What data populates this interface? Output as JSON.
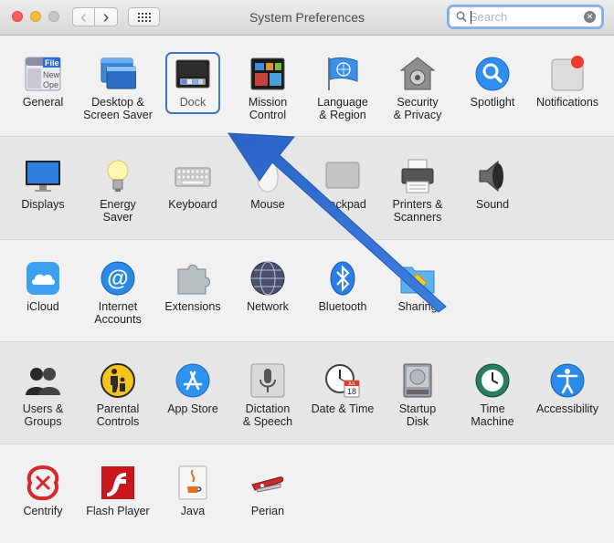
{
  "window": {
    "title": "System Preferences",
    "nav_back": "‹",
    "nav_forward": "›"
  },
  "search": {
    "placeholder": "Search",
    "value": "",
    "clear": "✕"
  },
  "selected": "Dock",
  "sections": [
    {
      "items": [
        {
          "id": "general",
          "label": "General",
          "icon": "general-icon",
          "icon_text": [
            "File",
            "New",
            "Ope"
          ]
        },
        {
          "id": "desktop",
          "label": "Desktop &\nScreen Saver",
          "icon": "desktop-screensaver-icon"
        },
        {
          "id": "dock",
          "label": "Dock",
          "icon": "dock-icon"
        },
        {
          "id": "mission",
          "label": "Mission\nControl",
          "icon": "mission-control-icon"
        },
        {
          "id": "language",
          "label": "Language\n& Region",
          "icon": "language-region-icon"
        },
        {
          "id": "security",
          "label": "Security\n& Privacy",
          "icon": "security-privacy-icon"
        },
        {
          "id": "spotlight",
          "label": "Spotlight",
          "icon": "spotlight-icon"
        },
        {
          "id": "notifications",
          "label": "Notifications",
          "icon": "notifications-icon"
        }
      ]
    },
    {
      "items": [
        {
          "id": "displays",
          "label": "Displays",
          "icon": "displays-icon"
        },
        {
          "id": "energy",
          "label": "Energy\nSaver",
          "icon": "energy-saver-icon"
        },
        {
          "id": "keyboard",
          "label": "Keyboard",
          "icon": "keyboard-icon"
        },
        {
          "id": "mouse",
          "label": "Mouse",
          "icon": "mouse-icon"
        },
        {
          "id": "trackpad",
          "label": "Trackpad",
          "icon": "trackpad-icon"
        },
        {
          "id": "printers",
          "label": "Printers &\nScanners",
          "icon": "printers-scanners-icon"
        },
        {
          "id": "sound",
          "label": "Sound",
          "icon": "sound-icon"
        }
      ]
    },
    {
      "items": [
        {
          "id": "icloud",
          "label": "iCloud",
          "icon": "icloud-icon"
        },
        {
          "id": "internet",
          "label": "Internet\nAccounts",
          "icon": "internet-accounts-icon"
        },
        {
          "id": "extensions",
          "label": "Extensions",
          "icon": "extensions-icon"
        },
        {
          "id": "network",
          "label": "Network",
          "icon": "network-icon"
        },
        {
          "id": "bluetooth",
          "label": "Bluetooth",
          "icon": "bluetooth-icon"
        },
        {
          "id": "sharing",
          "label": "Sharing",
          "icon": "sharing-icon"
        }
      ]
    },
    {
      "items": [
        {
          "id": "users",
          "label": "Users &\nGroups",
          "icon": "users-groups-icon"
        },
        {
          "id": "parental",
          "label": "Parental\nControls",
          "icon": "parental-controls-icon"
        },
        {
          "id": "appstore",
          "label": "App Store",
          "icon": "app-store-icon"
        },
        {
          "id": "dictation",
          "label": "Dictation\n& Speech",
          "icon": "dictation-speech-icon"
        },
        {
          "id": "datetime",
          "label": "Date & Time",
          "icon": "date-time-icon",
          "icon_text": [
            "JUL",
            "18"
          ]
        },
        {
          "id": "startup",
          "label": "Startup\nDisk",
          "icon": "startup-disk-icon"
        },
        {
          "id": "timemachine",
          "label": "Time\nMachine",
          "icon": "time-machine-icon"
        },
        {
          "id": "accessibility",
          "label": "Accessibility",
          "icon": "accessibility-icon"
        }
      ]
    },
    {
      "items": [
        {
          "id": "centrify",
          "label": "Centrify",
          "icon": "centrify-icon"
        },
        {
          "id": "flash",
          "label": "Flash Player",
          "icon": "flash-player-icon"
        },
        {
          "id": "java",
          "label": "Java",
          "icon": "java-icon"
        },
        {
          "id": "perian",
          "label": "Perian",
          "icon": "perian-icon"
        }
      ]
    }
  ],
  "colors": {
    "selection": "#3e74c9",
    "annotation_arrow": "#2f6fd0"
  }
}
